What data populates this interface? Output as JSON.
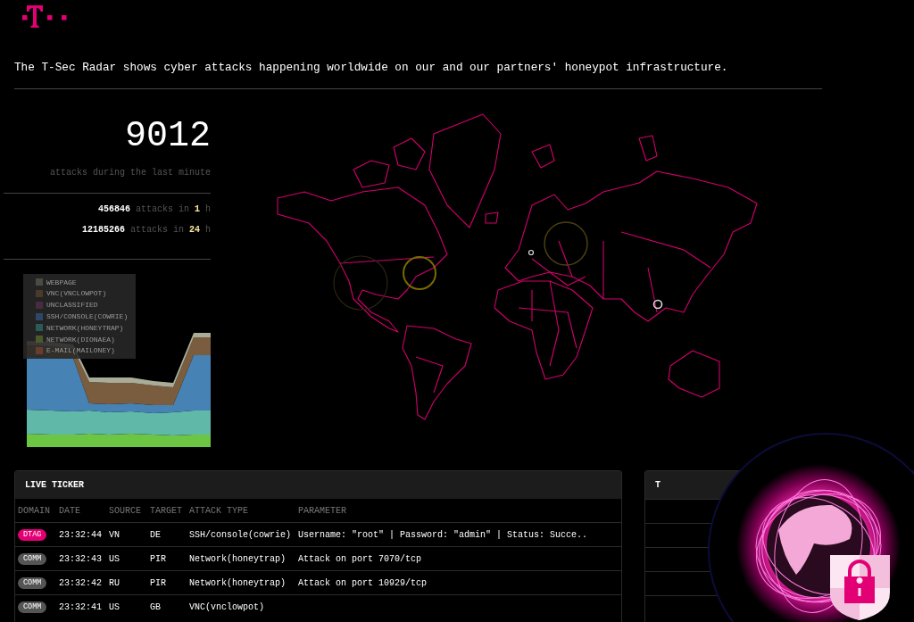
{
  "header": {
    "intro": "The T-Sec Radar shows cyber attacks happening worldwide on our and our partners' honeypot infrastructure."
  },
  "stats": {
    "last_minute": "9012",
    "last_minute_label": "attacks during the last minute",
    "totals": [
      {
        "count": "456846",
        "text": "attacks in",
        "period": "1",
        "unit": "h"
      },
      {
        "count": "12185266",
        "text": "attacks in",
        "period": "24",
        "unit": "h"
      }
    ]
  },
  "chart_legend": [
    {
      "label": "WEBPAGE",
      "color": "#4a4c44"
    },
    {
      "label": "VNC(VNCLOWPOT)",
      "color": "#4a3a2c"
    },
    {
      "label": "UNCLASSIFIED",
      "color": "#4a2c40"
    },
    {
      "label": "SSH/CONSOLE(COWRIE)",
      "color": "#2c4864"
    },
    {
      "label": "NETWORK(HONEYTRAP)",
      "color": "#2c5a56"
    },
    {
      "label": "NETWORK(DIONAEA)",
      "color": "#4a5a2c"
    },
    {
      "label": "E-MAIL(MAILONEY)",
      "color": "#6a3c2c"
    }
  ],
  "live_ticker": {
    "title": "LIVE TICKER",
    "columns": [
      "DOMAIN",
      "DATE",
      "SOURCE",
      "TARGET",
      "ATTACK TYPE",
      "PARAMETER"
    ],
    "rows": [
      {
        "domain": "DTAG",
        "color": "#e20074",
        "date": "23:32:44",
        "source": "VN",
        "target": "DE",
        "attack_type": "SSH/console(cowrie)",
        "parameter": "Username: \"root\" | Password: \"admin\" | Status: Succe.."
      },
      {
        "domain": "COMM",
        "color": "#555555",
        "date": "23:32:43",
        "source": "US",
        "target": "PIR",
        "attack_type": "Network(honeytrap)",
        "parameter": "Attack on port 7070/tcp"
      },
      {
        "domain": "COMM",
        "color": "#555555",
        "date": "23:32:42",
        "source": "RU",
        "target": "PIR",
        "attack_type": "Network(honeytrap)",
        "parameter": "Attack on port 10929/tcp"
      },
      {
        "domain": "COMM",
        "color": "#555555",
        "date": "23:32:41",
        "source": "US",
        "target": "GB",
        "attack_type": "VNC(vnclowpot)",
        "parameter": ""
      }
    ]
  },
  "side_panel": {
    "title": "T"
  }
}
